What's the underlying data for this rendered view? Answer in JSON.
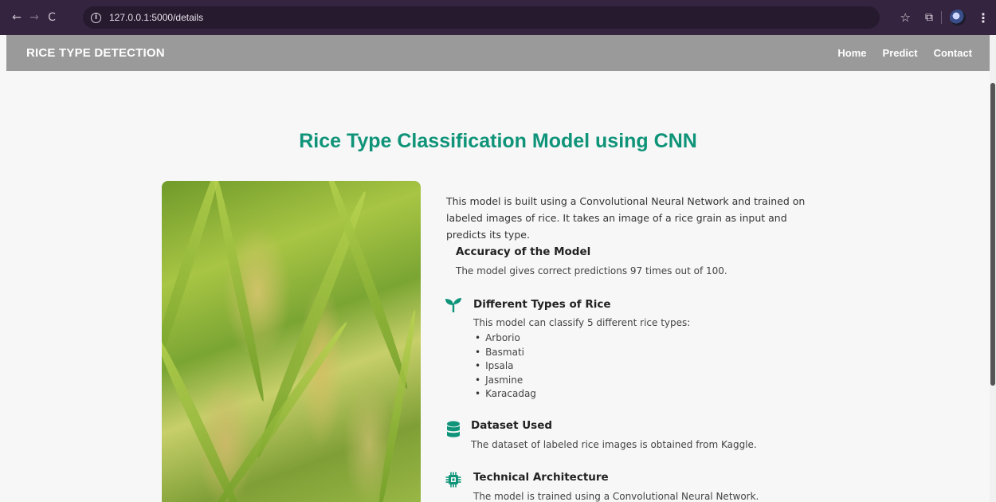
{
  "browser": {
    "url": "127.0.0.1:5000/details"
  },
  "header": {
    "brand": "RICE TYPE DETECTION",
    "nav": [
      "Home",
      "Predict",
      "Contact"
    ]
  },
  "main": {
    "title": "Rice Type Classification Model using CNN",
    "intro": "This model is built using a Convolutional Neural Network and trained on labeled images of rice. It takes an image of a rice grain as input and predicts its type.",
    "sections": {
      "accuracy": {
        "title": "Accuracy of the Model",
        "text": "The model gives correct predictions 97 times out of 100."
      },
      "types": {
        "title": "Different Types of Rice",
        "text": "This model can classify 5 different rice types:",
        "items": [
          "Arborio",
          "Basmati",
          "Ipsala",
          "Jasmine",
          "Karacadag"
        ]
      },
      "dataset": {
        "title": "Dataset Used",
        "text": "The dataset of labeled rice images is obtained from Kaggle."
      },
      "architecture": {
        "title": "Technical Architecture",
        "text": "The model is trained using a Convolutional Neural Network."
      }
    }
  },
  "colors": {
    "accent": "#0f9479",
    "header_bg": "#9a9a9a",
    "browser_bg": "#35243f"
  }
}
